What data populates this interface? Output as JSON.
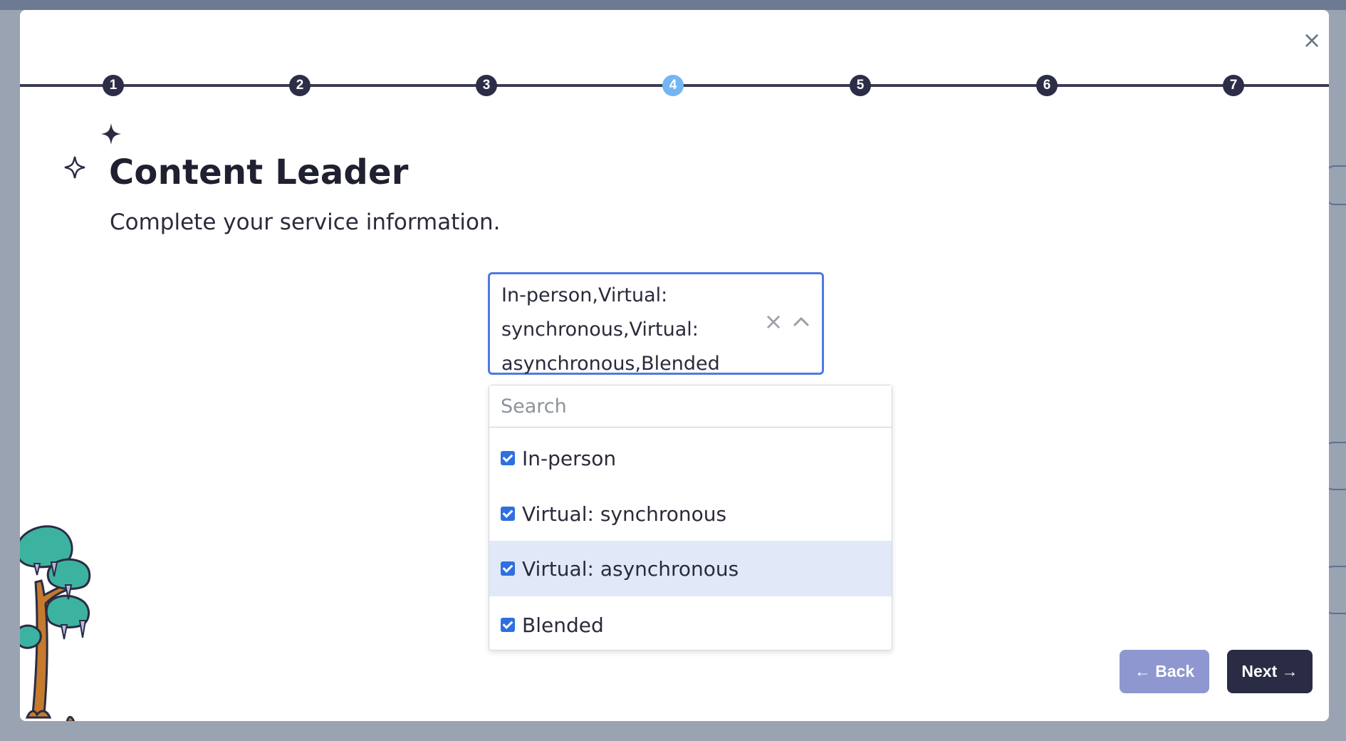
{
  "close_label": "×",
  "stepper": {
    "steps": [
      "1",
      "2",
      "3",
      "4",
      "5",
      "6",
      "7"
    ],
    "active_step": "4"
  },
  "header": {
    "title": "Content Leader",
    "subtitle": "Complete your service information."
  },
  "service_select": {
    "value_text": "In-person,Virtual: synchronous,Virtual: asynchronous,Blended",
    "clear_label": "×"
  },
  "dropdown": {
    "search_placeholder": "Search",
    "options": [
      {
        "label": "In-person",
        "checked": true
      },
      {
        "label": "Virtual: synchronous",
        "checked": true
      },
      {
        "label": "Virtual: asynchronous",
        "checked": true,
        "highlighted": true
      },
      {
        "label": "Blended",
        "checked": true
      }
    ]
  },
  "footer": {
    "back_label": "← Back",
    "next_label": "Next →"
  },
  "colors": {
    "accent_blue": "#4f79e3",
    "active_step": "#74b6f2",
    "dark": "#2a2b44",
    "back_button": "#8e97cf",
    "highlight_row": "#e1e9f8"
  }
}
